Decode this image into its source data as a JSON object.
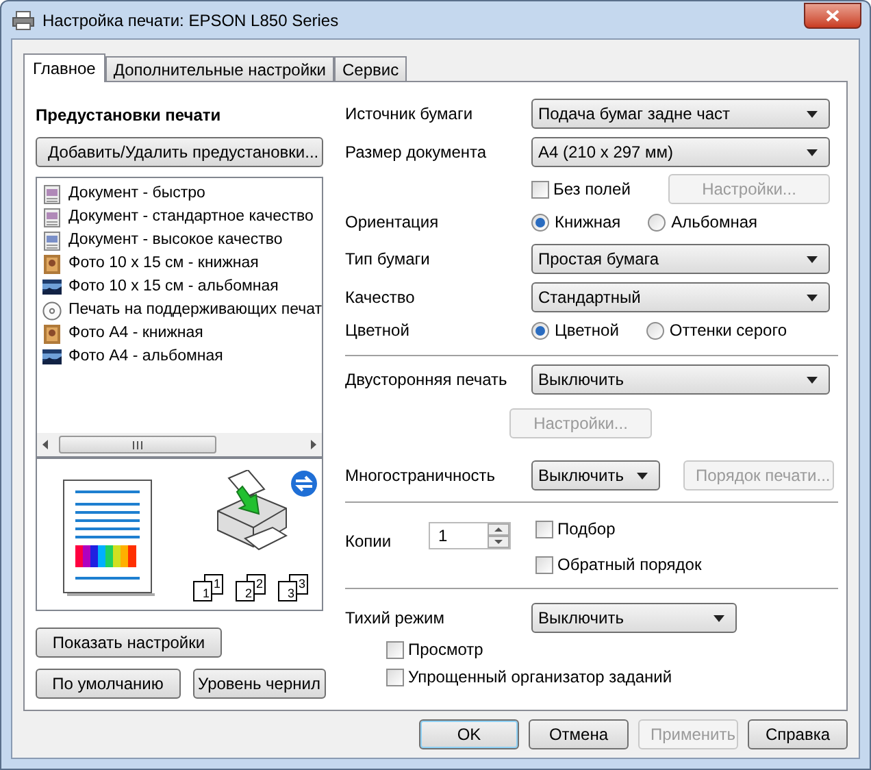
{
  "window": {
    "title": "Настройка печати: EPSON L850 Series"
  },
  "tabs": [
    {
      "label": "Главное",
      "selected": true
    },
    {
      "label": "Дополнительные настройки",
      "selected": false
    },
    {
      "label": "Сервис",
      "selected": false
    }
  ],
  "presets": {
    "title": "Предустановки печати",
    "add_button": "Добавить/Удалить предустановки...",
    "items": [
      {
        "kind": "document",
        "label": "Документ - быстро"
      },
      {
        "kind": "document",
        "label": "Документ - стандартное качество"
      },
      {
        "kind": "document_hq",
        "label": "Документ - высокое качество"
      },
      {
        "kind": "photo_portrait",
        "label": "Фото 10 x 15 см - книжная"
      },
      {
        "kind": "photo_landscape",
        "label": "Фото 10 x 15 см - альбомная"
      },
      {
        "kind": "disc",
        "label": "Печать на поддерживающих печат"
      },
      {
        "kind": "photo_portrait",
        "label": "Фото A4 - книжная"
      },
      {
        "kind": "photo_landscape",
        "label": "Фото A4 - альбомная"
      }
    ]
  },
  "preview": {
    "collate_pages": [
      {
        "front": "1",
        "back": "1"
      },
      {
        "front": "2",
        "back": "2"
      },
      {
        "front": "3",
        "back": "3"
      }
    ]
  },
  "left_buttons": {
    "show_settings": "Показать настройки",
    "defaults": "По умолчанию",
    "ink_levels": "Уровень чернил"
  },
  "sections": [
    [
      {
        "kind": "select",
        "label": "Источник бумаги",
        "value": "Подача бумаг задне част"
      },
      {
        "kind": "select",
        "label": "Размер документа",
        "value": "A4 (210 x 297 мм)"
      },
      {
        "kind": "checkbox_button",
        "label": "Без полей",
        "checked": false,
        "button": "Настройки...",
        "disabled": true
      },
      {
        "kind": "radio",
        "label": "Ориентация",
        "options": [
          {
            "label": "Книжная",
            "selected": true
          },
          {
            "label": "Альбомная",
            "selected": false
          }
        ]
      },
      {
        "kind": "select",
        "label": "Тип бумаги",
        "value": "Простая бумага"
      },
      {
        "kind": "select",
        "label": "Качество",
        "value": "Стандартный"
      },
      {
        "kind": "radio",
        "label": "Цветной",
        "options": [
          {
            "label": "Цветной",
            "selected": true
          },
          {
            "label": "Оттенки серого",
            "selected": false
          }
        ]
      }
    ],
    [
      {
        "kind": "select",
        "label": "Двусторонняя печать",
        "value": "Выключить"
      },
      {
        "kind": "button",
        "button": "Настройки...",
        "disabled": true
      },
      {
        "kind": "select_button",
        "label": "Многостраничность",
        "value": "Выключить",
        "button": "Порядок печати...",
        "disabled": true
      }
    ],
    [
      {
        "kind": "copies",
        "label": "Копии",
        "value": "1",
        "options": [
          {
            "label": "Подбор",
            "checked": false
          },
          {
            "label": "Обратный порядок",
            "checked": false
          }
        ]
      }
    ],
    [
      {
        "kind": "select_narrow",
        "label": "Тихий режим",
        "value": "Выключить"
      },
      {
        "kind": "checkbox",
        "label": "Просмотр",
        "checked": false
      },
      {
        "kind": "checkbox",
        "label": "Упрощенный организатор заданий",
        "checked": false
      }
    ]
  ],
  "dialog_buttons": [
    {
      "label": "OK",
      "default": true,
      "disabled": false
    },
    {
      "label": "Отмена",
      "default": false,
      "disabled": false
    },
    {
      "label": "Применить",
      "default": false,
      "disabled": true
    },
    {
      "label": "Справка",
      "default": false,
      "disabled": false
    }
  ]
}
